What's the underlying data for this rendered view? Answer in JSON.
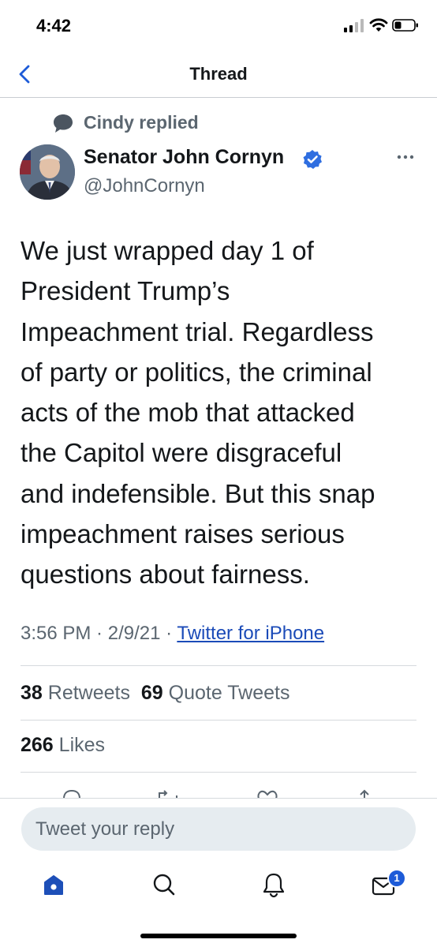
{
  "status_bar": {
    "time": "4:42"
  },
  "nav": {
    "title": "Thread"
  },
  "context": {
    "replied_text": "Cindy replied"
  },
  "author": {
    "name": "Senator John Cornyn",
    "handle": "@JohnCornyn",
    "verified": true
  },
  "tweet": {
    "lines": [
      "We just wrapped day 1 of",
      "President Trump’s",
      "Impeachment trial. Regardless",
      "of party or politics, the criminal",
      "acts of the mob that attacked",
      "the Capitol were disgraceful",
      "and indefensible. But this snap",
      "impeachment raises serious",
      "questions about fairness."
    ],
    "time": "3:56 PM",
    "date": "2/9/21",
    "source": "Twitter for iPhone"
  },
  "stats": {
    "retweets_count": "38",
    "retweets_label": "Retweets",
    "quotes_count": "69",
    "quotes_label": "Quote Tweets",
    "likes_count": "266",
    "likes_label": "Likes"
  },
  "reply": {
    "placeholder": "Tweet your reply"
  },
  "tabs": {
    "messages_badge": "1"
  },
  "colors": {
    "accent": "#1d5bd8",
    "verified": "#2f6ee0",
    "secondary_text": "#5b6670"
  },
  "icons": [
    "back-chevron-icon",
    "speech-bubble-icon",
    "verified-badge-icon",
    "more-icon",
    "home-icon",
    "search-icon",
    "bell-icon",
    "mail-icon"
  ]
}
